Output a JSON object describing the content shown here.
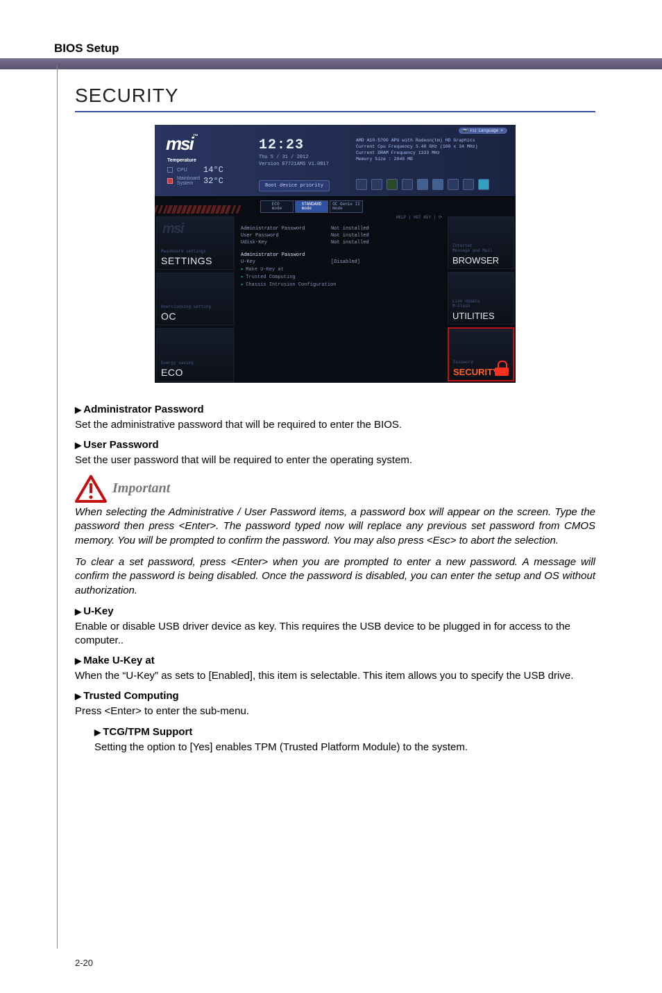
{
  "header": {
    "label": "BIOS Setup"
  },
  "page": {
    "title": "SECURITY",
    "footer_page": "2-20"
  },
  "bios": {
    "brand": "msi",
    "temperature_label": "Temperature",
    "cpu_label": "CPU",
    "cpu_temp": "14°C",
    "sys_label": "Mainboard\nSystem",
    "sys_temp": "32°C",
    "clock": "12:23",
    "date": "Thu  5 / 31 / 2012",
    "version": "Version E7721AMS V1.0B17",
    "boot_button": "Boot device priority",
    "lang_button": "Language",
    "sys_info": "AMD A10-5700 APU with Radeon(tm) HD Graphics\nCurrent Cpu Frequency 3.40 GHz (100 x 34 MHz)\nCurrent DRAM Frequency 1333 MHz\nMemory Size : 2048 MB",
    "tabs": {
      "eco": "ECO\nmode",
      "std": "STANDARD\nmode",
      "oc": "OC Genie II\nmode"
    },
    "left_nav": {
      "settings_mini": "Mainboard settings",
      "settings": "SETTINGS",
      "oc_mini": "Overclocking setting",
      "oc": "OC",
      "eco_mini": "Energy saving",
      "eco": "ECO"
    },
    "right_nav": {
      "browser_mini": "Internet\nMessage and Mail",
      "browser": "BROWSER",
      "util_mini": "Live Update\nM-Flash",
      "util": "UTILITIES",
      "sec_mini": "Password",
      "sec": "SECURITY"
    },
    "center": {
      "help": "HELP  |  HOT KEY  |  ⟳",
      "rows": [
        {
          "k": "Administrator Password",
          "v": "Not installed"
        },
        {
          "k": "User Password",
          "v": "Not installed"
        },
        {
          "k": "Udisk-Key",
          "v": "Not installed"
        }
      ],
      "menu": [
        {
          "label": "Administrator Password",
          "sel": true
        },
        {
          "label": "U-Key",
          "val": "[Disabled]"
        },
        {
          "label": "Make U-Key at",
          "arrow": true
        },
        {
          "label": "Trusted Computing",
          "arrow": true
        },
        {
          "label": "Chassis Intrusion Configuration",
          "arrow": true
        }
      ]
    }
  },
  "items": {
    "admin_head": "Administrator Password",
    "admin_desc": "Set the administrative password that will be required to enter the BIOS.",
    "user_head": "User Password",
    "user_desc": "Set the user password that will be required to enter the operating system.",
    "important_label": "Important",
    "important_p1": "When selecting the Administrative / User Password items, a password box will appear on the screen. Type the password then press <Enter>. The password typed now will replace any previous set password from CMOS memory. You will be prompted to confirm the password. You may also press <Esc> to abort the selection.",
    "important_p2": "To clear a set password, press <Enter> when you are prompted to enter a new password. A message will confirm the password is being disabled. Once the password is disabled, you can enter the setup and OS without authorization.",
    "ukey_head": "U-Key",
    "ukey_desc": "Enable or disable USB driver device as key. This requires the USB device to be plugged in for access to the computer..",
    "make_head": "Make U-Key at",
    "make_desc": "When the “U-Key” as sets to [Enabled], this item is selectable. This item allows you to specify the USB drive.",
    "trusted_head": "Trusted Computing",
    "trusted_desc": "Press <Enter> to enter the sub-menu.",
    "tpm_head": "TCG/TPM Support",
    "tpm_desc": "Setting the option to [Yes] enables TPM (Trusted Platform Module) to the system."
  }
}
